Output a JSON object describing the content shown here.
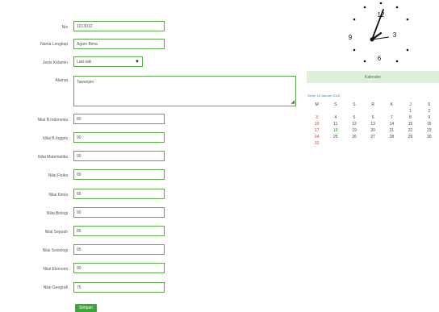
{
  "form": {
    "nis": {
      "label": "Nis",
      "value": "1213012"
    },
    "nama": {
      "label": "Nama Lengkap",
      "value": "Agam Bima"
    },
    "jenis_kelamin": {
      "label": "Jenis Kelamin",
      "value": "Laki-laki",
      "caret": "▼"
    },
    "alamat": {
      "label": "Alamat",
      "value": "Tawanjen",
      "resize": "◢"
    },
    "nilai": [
      {
        "label": "Nilai B.Indonesia",
        "value": "80"
      },
      {
        "label": "Nilai B.Inggris",
        "value": "90"
      },
      {
        "label": "Nilai Matematika",
        "value": "90"
      },
      {
        "label": "Nilai Fisika",
        "value": "89"
      },
      {
        "label": "Nilai Kimia",
        "value": "85"
      },
      {
        "label": "Nilai Biologi",
        "value": "90"
      },
      {
        "label": "Nilai Sejarah",
        "value": "85"
      },
      {
        "label": "Nilai Sosiologi",
        "value": "95"
      },
      {
        "label": "Nilai Ekonomi",
        "value": "90"
      },
      {
        "label": "Nilai Geografi",
        "value": "75"
      }
    ],
    "submit_label": "Simpan"
  },
  "clock": {
    "n12": "12",
    "n3": "3",
    "n6": "6",
    "n9": "9"
  },
  "calendar": {
    "title": "Kalender",
    "caption": "Senin 18 Januari 2016",
    "days": [
      "M",
      "S",
      "S",
      "R",
      "K",
      "J",
      "S"
    ],
    "weeks": [
      [
        "",
        "",
        "",
        "",
        "",
        "1",
        "2"
      ],
      [
        "3",
        "4",
        "5",
        "6",
        "7",
        "8",
        "9"
      ],
      [
        "10",
        "11",
        "12",
        "13",
        "14",
        "15",
        "16"
      ],
      [
        "17",
        "18",
        "19",
        "20",
        "21",
        "22",
        "23"
      ],
      [
        "24",
        "25",
        "26",
        "27",
        "28",
        "29",
        "30"
      ],
      [
        "31",
        "",
        "",
        "",
        "",
        "",
        ""
      ]
    ],
    "today": "18",
    "colors": {
      "sunday": "#e03030",
      "today": "#2fa82f",
      "header_bg": "#dff0d8",
      "accent": "#3ca53c"
    }
  }
}
